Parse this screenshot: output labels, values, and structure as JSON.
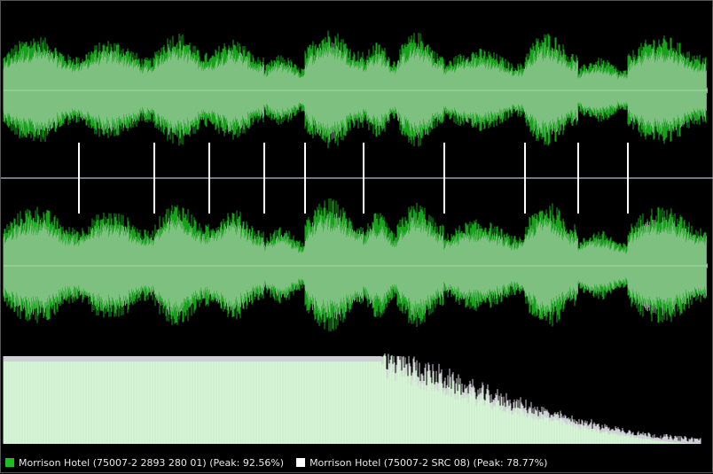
{
  "colors": {
    "background": "#000000",
    "track_a": "#17a11a",
    "track_b": "#cfd2d6",
    "overlap": "#7ec07f",
    "centerline": "#9fd49f",
    "divider": "#9aa0a8",
    "spectrum_fill": "#d8f5d8",
    "spectrum_peaks": "#cfcfd6"
  },
  "legend": {
    "track_a": {
      "label": "Morrison Hotel (75007-2 2893 280 01) (Peak: 92.56%)",
      "peak_percent": 92.56,
      "color": "#19c21b",
      "icon": "green-square-icon"
    },
    "track_b": {
      "label": "Morrison Hotel (75007-2 SRC 08) (Peak: 78.77%)",
      "peak_percent": 78.77,
      "color": "#ffffff",
      "icon": "white-square-icon"
    }
  }
}
